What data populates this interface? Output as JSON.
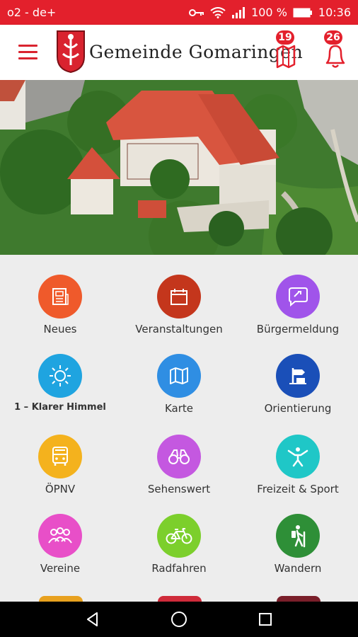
{
  "status_bar": {
    "carrier": "o2 - de+",
    "battery": "100 %",
    "time": "10:36"
  },
  "header": {
    "title": "Gemeinde Gomaringen",
    "map_badge": "19",
    "bell_badge": "26"
  },
  "colors": {
    "primary": "#e3202c"
  },
  "tiles": [
    {
      "label": "Neues",
      "color": "#ef5a2b",
      "icon": "newspaper-icon"
    },
    {
      "label": "Veranstaltungen",
      "color": "#c4361c",
      "icon": "calendar-icon"
    },
    {
      "label": "Bürgermeldung",
      "color": "#a054ea",
      "icon": "speech-bubble-icon"
    },
    {
      "label": "1 – Klarer Himmel",
      "color": "#1fa4e0",
      "icon": "sun-icon"
    },
    {
      "label": "Karte",
      "color": "#2f8ee3",
      "icon": "map-icon"
    },
    {
      "label": "Orientierung",
      "color": "#1a4fb8",
      "icon": "signpost-icon"
    },
    {
      "label": "ÖPNV",
      "color": "#f4b21d",
      "icon": "bus-icon"
    },
    {
      "label": "Sehenswert",
      "color": "#c458e0",
      "icon": "binoculars-icon"
    },
    {
      "label": "Freizeit & Sport",
      "color": "#1fc7c7",
      "icon": "person-exercise-icon"
    },
    {
      "label": "Vereine",
      "color": "#e84fc8",
      "icon": "group-icon"
    },
    {
      "label": "Radfahren",
      "color": "#7ccf2c",
      "icon": "bicycle-icon"
    },
    {
      "label": "Wandern",
      "color": "#2e8f37",
      "icon": "hiker-icon"
    }
  ]
}
